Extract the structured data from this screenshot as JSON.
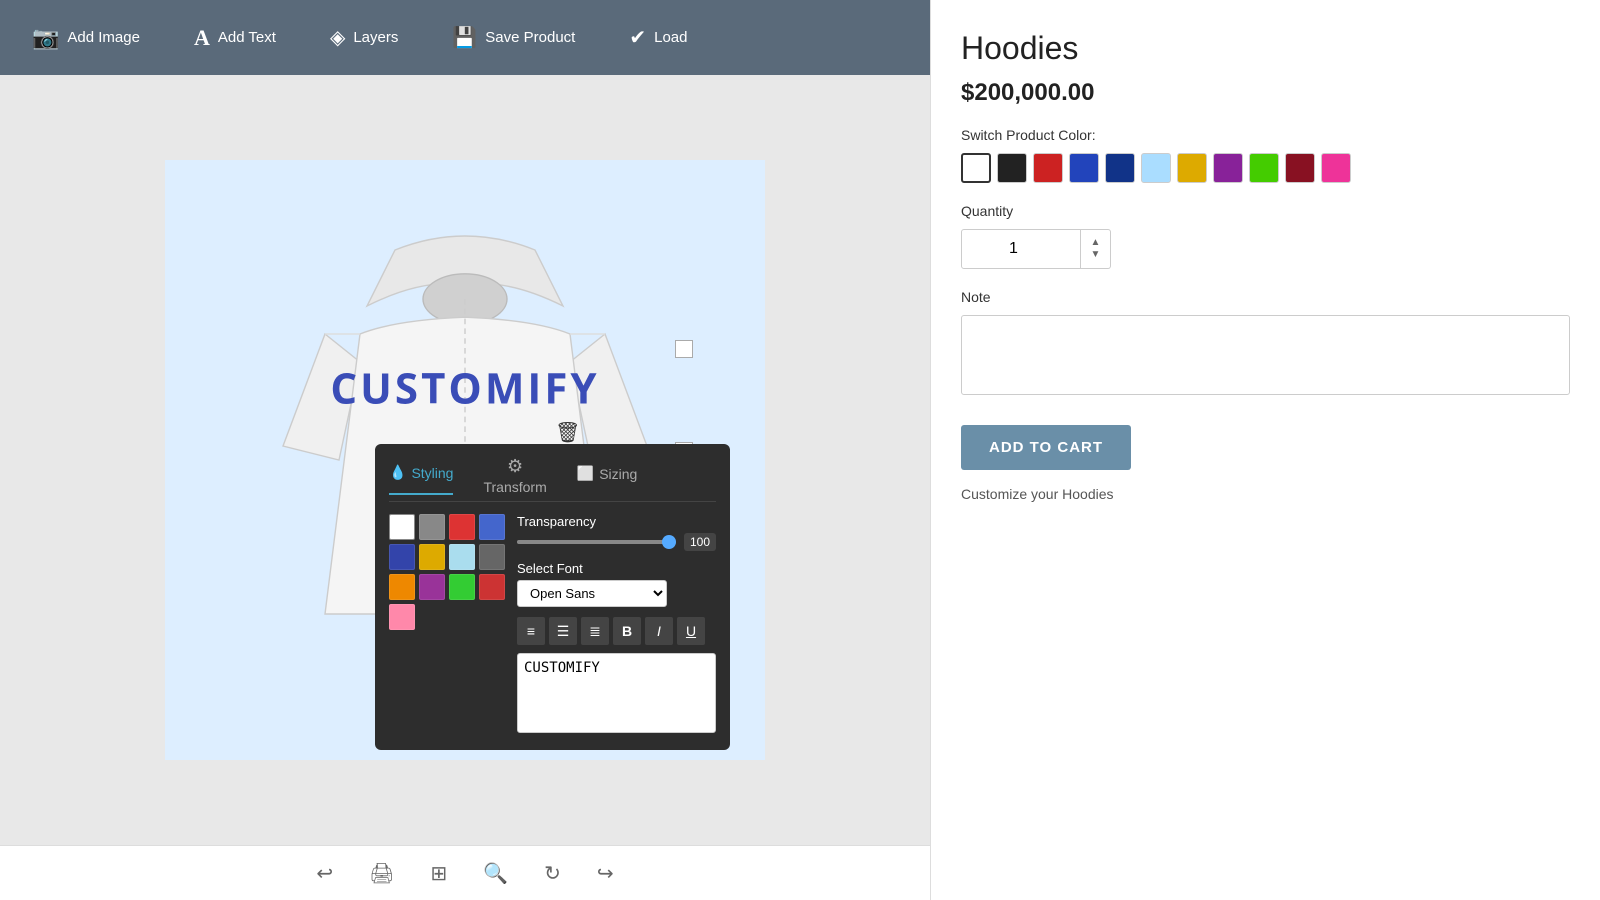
{
  "toolbar": {
    "add_image_label": "Add Image",
    "add_text_label": "Add Text",
    "layers_label": "Layers",
    "save_product_label": "Save Product",
    "load_label": "Load"
  },
  "canvas": {
    "text": "CUSTOMIFY"
  },
  "styling_panel": {
    "tab_styling": "Styling",
    "tab_transform": "Transform",
    "tab_sizing": "Sizing",
    "transparency_label": "Transparency",
    "transparency_value": "100",
    "select_font_label": "Select Font",
    "font_value": "Open Sans",
    "text_content": "CUSTOMIFY",
    "colors": [
      {
        "hex": "#ffffff"
      },
      {
        "hex": "#888888"
      },
      {
        "hex": "#dd3333"
      },
      {
        "hex": "#4466cc"
      },
      {
        "hex": "#3344aa"
      },
      {
        "hex": "#ddaa00"
      },
      {
        "hex": "#aaddee"
      },
      {
        "hex": "#666666"
      },
      {
        "hex": "#ee8800"
      },
      {
        "hex": "#993399"
      },
      {
        "hex": "#33cc33"
      },
      {
        "hex": "#cc3333"
      },
      {
        "hex": "#ff88aa"
      }
    ]
  },
  "right_panel": {
    "title": "Hoodies",
    "price": "$200,000.00",
    "switch_color_label": "Switch Product Color:",
    "colors": [
      {
        "hex": "#ffffff",
        "selected": true
      },
      {
        "hex": "#222222"
      },
      {
        "hex": "#cc2222"
      },
      {
        "hex": "#2244bb"
      },
      {
        "hex": "#113388"
      },
      {
        "hex": "#aaddff"
      },
      {
        "hex": "#ddaa00"
      },
      {
        "hex": "#882299"
      },
      {
        "hex": "#44cc00"
      },
      {
        "hex": "#881122"
      },
      {
        "hex": "#ee3399"
      }
    ],
    "quantity_label": "Quantity",
    "quantity_value": "1",
    "note_label": "Note",
    "add_to_cart_label": "ADD TO CART",
    "customize_text": "Customize your Hoodies"
  },
  "bottom_toolbar": {
    "undo_label": "↩",
    "print_label": "🖨",
    "grid_label": "⊞",
    "zoom_label": "🔍",
    "refresh_label": "↻",
    "redo_label": "↪"
  }
}
